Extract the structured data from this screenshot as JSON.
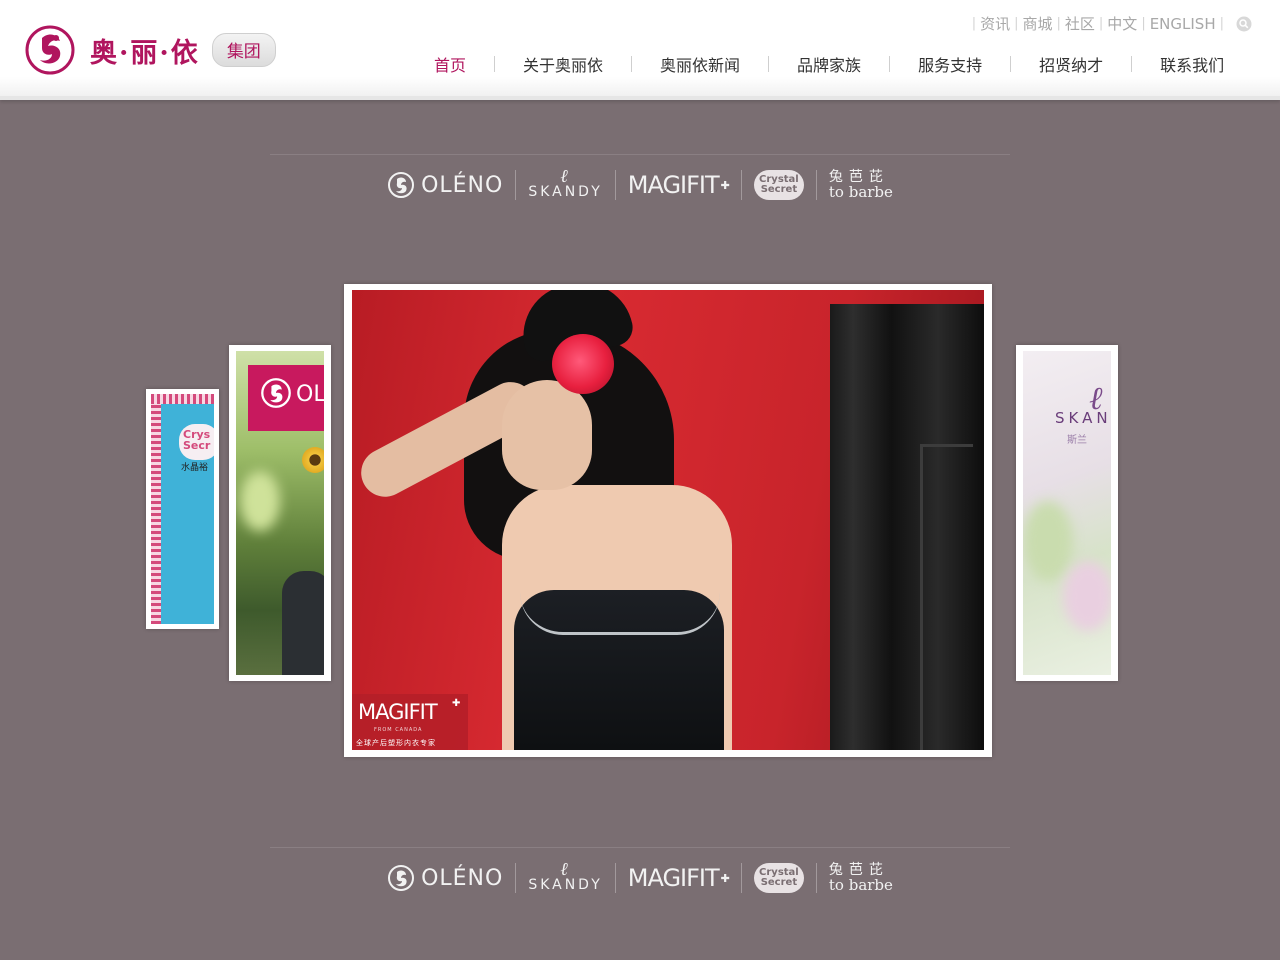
{
  "header": {
    "logo_text": "奥·丽·依",
    "logo_badge": "集团",
    "util_links": [
      "资讯",
      "商城",
      "社区",
      "中文",
      "ENGLISH"
    ],
    "nav": [
      {
        "label": "首页",
        "active": true
      },
      {
        "label": "关于奥丽依",
        "active": false
      },
      {
        "label": "奥丽依新闻",
        "active": false
      },
      {
        "label": "品牌家族",
        "active": false
      },
      {
        "label": "服务支持",
        "active": false
      },
      {
        "label": "招贤纳才",
        "active": false
      },
      {
        "label": "联系我们",
        "active": false
      }
    ]
  },
  "brands": {
    "oleno": "OLÉNO",
    "skandy": "SKANDY",
    "magifit": "MAGIFIT",
    "secret_1": "Crystal",
    "secret_2": "Secret",
    "tobarbe_cn": "兔芭芘",
    "tobarbe_en": "to barbe"
  },
  "slides": {
    "main_badge_title": "MAGIFIT",
    "main_badge_sub": "FROM CANADA",
    "main_badge_caption": "全球产后塑形内衣专家",
    "left_brand": "OL",
    "far_left_brand_1": "Crys",
    "far_left_brand_2": "Secr",
    "far_left_cn": "水晶裕",
    "right_brand": "SKAN",
    "right_cn": "斯兰"
  },
  "colors": {
    "brand": "#b0155e",
    "background": "#7a6e72"
  }
}
